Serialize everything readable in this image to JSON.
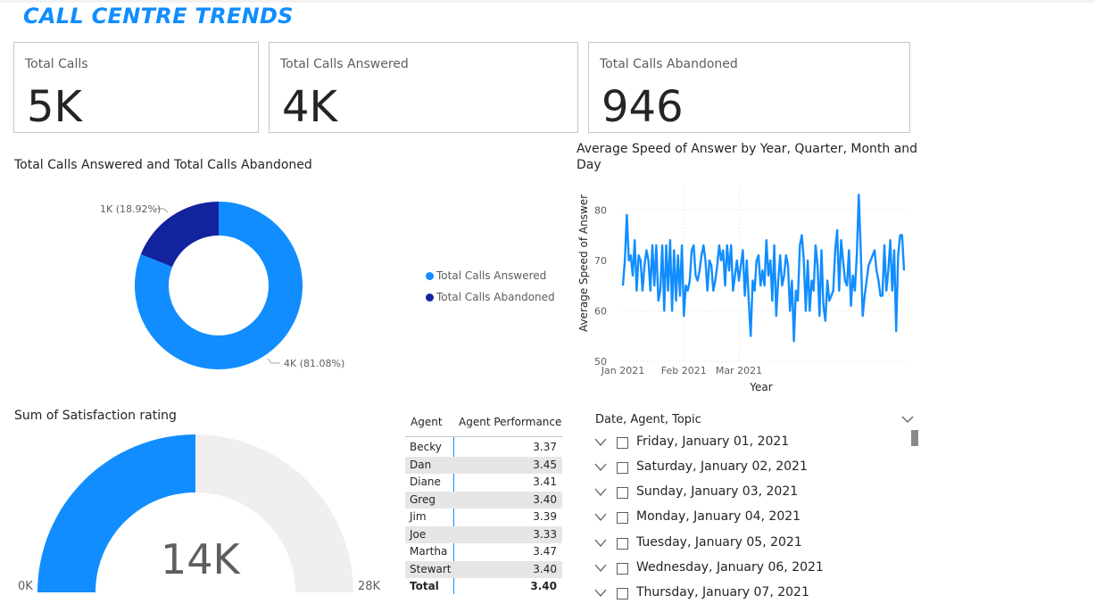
{
  "report_title": "CALL CENTRE TRENDS",
  "cards": [
    {
      "label": "Total Calls",
      "value": "5K"
    },
    {
      "label": "Total Calls Answered",
      "value": "4K"
    },
    {
      "label": "Total Calls Abandoned",
      "value": "946"
    }
  ],
  "donut": {
    "title": "Total Calls Answered and Total Calls Abandoned",
    "slices": [
      {
        "name": "Total Calls Answered",
        "value": 4000,
        "percent": 81.08,
        "label": "4K (81.08%)",
        "color": "#118dff"
      },
      {
        "name": "Total Calls Abandoned",
        "value": 946,
        "percent": 18.92,
        "label": "1K (18.92%)",
        "color": "#12239e"
      }
    ]
  },
  "line_chart": {
    "title": "Average Speed of Answer by Year, Quarter, Month and Day",
    "xlabel": "Year",
    "ylabel": "Average Speed of Answer",
    "y_ticks": [
      "50",
      "60",
      "70",
      "80"
    ],
    "x_ticks": [
      "Jan 2021",
      "Feb 2021",
      "Mar 2021"
    ],
    "color": "#118dff"
  },
  "chart_data": {
    "type": "line",
    "title": "Average Speed of Answer by Year, Quarter, Month and Day",
    "xlabel": "Year",
    "ylabel": "Average Speed of Answer",
    "ylim": [
      50,
      80
    ],
    "x_range": [
      "2021-01-01",
      "2021-03-31"
    ],
    "x_ticks": [
      "Jan 2021",
      "Feb 2021",
      "Mar 2021"
    ],
    "grid": true,
    "series": [
      {
        "values": [
          65,
          70,
          79,
          70,
          71,
          67,
          74,
          64,
          71,
          70,
          64,
          69,
          72,
          70,
          64,
          73,
          65,
          73,
          62,
          64,
          73,
          60,
          73,
          64,
          74,
          60,
          72,
          62,
          71,
          63,
          73,
          59,
          65,
          64,
          66,
          72,
          73,
          67,
          66,
          68,
          71,
          73,
          70,
          64,
          70,
          69,
          64,
          66,
          69,
          73,
          70,
          72,
          65,
          73,
          68,
          73,
          64,
          67,
          70,
          66,
          69,
          72,
          63,
          70,
          62,
          55,
          66,
          64,
          70,
          71,
          65,
          68,
          65,
          74,
          67,
          70,
          62,
          73,
          59,
          66,
          71,
          65,
          67,
          71,
          69,
          60,
          66,
          54,
          64,
          62,
          73,
          75,
          70,
          60,
          70,
          60,
          66,
          64,
          73,
          69,
          59,
          72,
          61,
          58,
          66,
          62,
          63,
          64,
          72,
          76,
          64,
          74,
          70,
          66,
          65,
          72,
          61,
          67,
          64,
          71,
          83,
          72,
          59,
          63,
          66,
          69,
          70,
          71,
          72,
          68,
          66,
          63,
          63,
          73,
          64,
          68,
          74,
          64,
          72,
          56,
          71,
          75,
          75,
          68
        ]
      }
    ]
  },
  "gauge": {
    "title": "Sum of Satisfaction rating",
    "value": 14000,
    "value_label": "14K",
    "min_label": "0K",
    "max_label": "28K",
    "min": 0,
    "max": 28000,
    "fill_color": "#118dff",
    "track_color": "#f0efee"
  },
  "agent_table": {
    "headers": [
      "Agent",
      "Agent Performance"
    ],
    "rows": [
      {
        "agent": "Becky",
        "perf": "3.37"
      },
      {
        "agent": "Dan",
        "perf": "3.45"
      },
      {
        "agent": "Diane",
        "perf": "3.41"
      },
      {
        "agent": "Greg",
        "perf": "3.40"
      },
      {
        "agent": "Jim",
        "perf": "3.39"
      },
      {
        "agent": "Joe",
        "perf": "3.33"
      },
      {
        "agent": "Martha",
        "perf": "3.47"
      },
      {
        "agent": "Stewart",
        "perf": "3.40"
      }
    ],
    "total_label": "Total",
    "total_value": "3.40"
  },
  "slicer": {
    "header": "Date, Agent, Topic",
    "items": [
      "Friday, January 01, 2021",
      "Saturday, January 02, 2021",
      "Sunday, January 03, 2021",
      "Monday, January 04, 2021",
      "Tuesday, January 05, 2021",
      "Wednesday, January 06, 2021",
      "Thursday, January 07, 2021"
    ]
  }
}
